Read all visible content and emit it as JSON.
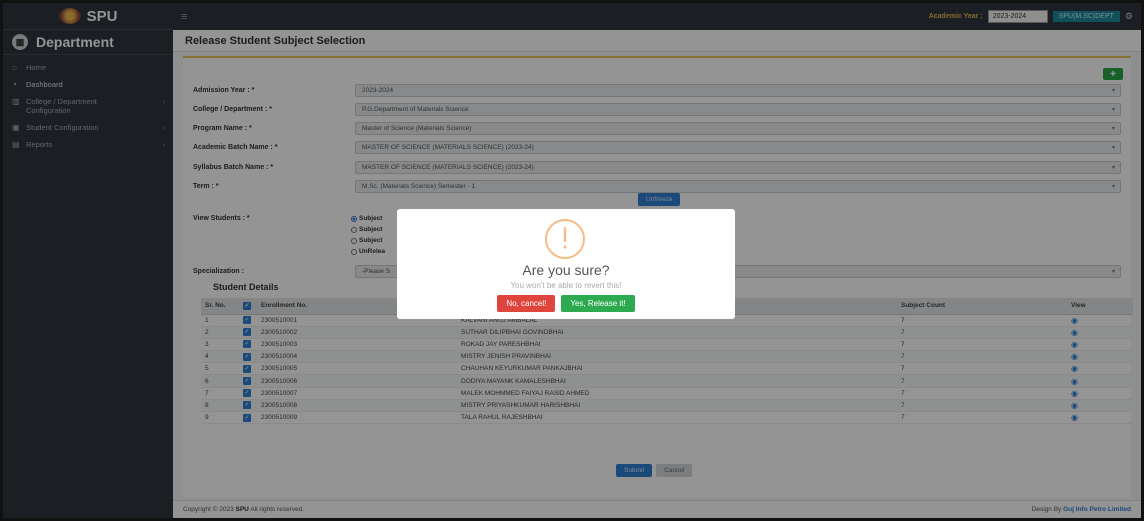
{
  "app": {
    "brand": "SPU"
  },
  "sidebar": {
    "dept_title": "Department",
    "items": [
      {
        "label": "Home",
        "icon": "home-icon"
      },
      {
        "label": "Dashboard",
        "icon": "dashboard-icon"
      },
      {
        "label": "College / Department Configuration",
        "icon": "building-icon"
      },
      {
        "label": "Student Configuration",
        "icon": "student-icon"
      },
      {
        "label": "Reports",
        "icon": "report-icon"
      }
    ]
  },
  "topbar": {
    "academic_year_label": "Academic Year :",
    "academic_year_value": "2023-2024",
    "user": "SPU(M.SC)DEPT"
  },
  "page": {
    "title": "Release Student Subject Selection"
  },
  "form": {
    "fields": [
      {
        "label": "Admission Year : *",
        "value": "2023-2024"
      },
      {
        "label": "College / Department : *",
        "value": "P.G.Department of Materials Science"
      },
      {
        "label": "Program Name : *",
        "value": "Master of Science (Materials Science)"
      },
      {
        "label": "Academic Batch Name : *",
        "value": "MASTER OF SCIENCE (MATERIALS SCIENCE) (2023-24)"
      },
      {
        "label": "Syllabus Batch Name : *",
        "value": "MASTER OF SCIENCE (MATERIALS SCIENCE) (2023-24)"
      },
      {
        "label": "Term : *",
        "value": "M.Sc. (Materials Science) Semester - 1"
      }
    ],
    "unfreeze_label": "Unfreeze",
    "view_students_label": "View Students : *",
    "view_options": [
      "Subject",
      "Subject",
      "Subject",
      "UnRelea"
    ],
    "specialization_label": "Specialization :",
    "specialization_value": "-Please S"
  },
  "student_details": {
    "title": "Student Details",
    "headers": [
      "Sr. No.",
      "",
      "Enrollment No.",
      "",
      "Subject Count",
      "View"
    ],
    "rows": [
      {
        "sr": "1",
        "enroll": "2300510001",
        "name": "KALVANI ANUJ AMBALAL",
        "count": "7"
      },
      {
        "sr": "2",
        "enroll": "2300510002",
        "name": "SUTHAR DILIPBHAI GOVINDBHAI",
        "count": "7"
      },
      {
        "sr": "3",
        "enroll": "2300510003",
        "name": "ROKAD JAY PARESHBHAI",
        "count": "7"
      },
      {
        "sr": "4",
        "enroll": "2300510004",
        "name": "MISTRY JENISH PRAVINBHAI",
        "count": "7"
      },
      {
        "sr": "5",
        "enroll": "2300510005",
        "name": "CHAUHAN KEYURKUMAR PANKAJBHAI",
        "count": "7"
      },
      {
        "sr": "6",
        "enroll": "2300510006",
        "name": "DODIYA MAYANK KAMALESHBHAI",
        "count": "7"
      },
      {
        "sr": "7",
        "enroll": "2300510007",
        "name": "MALEK MOHMMED FAIYAJ RASID AHMED",
        "count": "7"
      },
      {
        "sr": "8",
        "enroll": "2300510008",
        "name": "MISTRY PRIYASHKUMAR HARISHBHAI",
        "count": "7"
      },
      {
        "sr": "9",
        "enroll": "2300510009",
        "name": "TALA RAHUL RAJESHBHAI",
        "count": "7"
      }
    ],
    "submit_label": "Submit",
    "cancel_label": "Cancel"
  },
  "footer": {
    "copyright_prefix": "Copyright © 2023",
    "copyright_brand": "SPU",
    "copyright_suffix": "All rights reserved.",
    "design_prefix": "Design By",
    "design_company": "Guj Info Petro Limited"
  },
  "modal": {
    "title": "Are you sure?",
    "text": "You won't be able to revert this!",
    "cancel_label": "No, cancel!",
    "confirm_label": "Yes, Release it!",
    "icon": "warning-icon",
    "warning_color": "#f8bb86"
  }
}
